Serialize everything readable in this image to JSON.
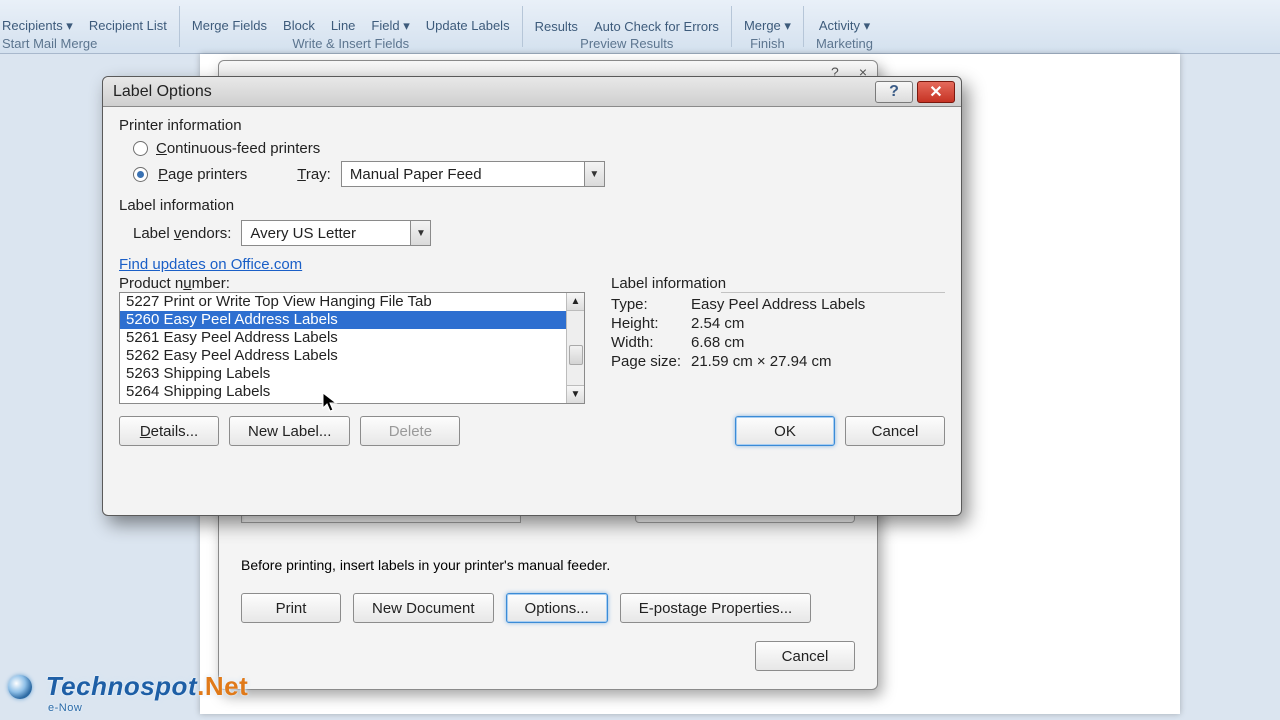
{
  "ribbon": {
    "items_top": [
      "Recipients ▾",
      "Recipient List",
      "Merge Fields",
      "Block",
      "Line",
      "Field ▾",
      "Update Labels",
      "Results",
      "Auto Check for Errors",
      "Merge ▾",
      "Activity ▾"
    ],
    "groups": [
      "Start Mail Merge",
      "Write & Insert Fields",
      "Preview Results",
      "Finish",
      "Marketing"
    ]
  },
  "dialog": {
    "title": "Label Options",
    "printer_info_head": "Printer information",
    "radio_continuous": "Continuous-feed printers",
    "radio_page": "Page printers",
    "tray_label": "Tray:",
    "tray_value": "Manual Paper Feed",
    "label_info_head": "Label information",
    "vendors_label": "Label vendors:",
    "vendors_value": "Avery US Letter",
    "find_updates": "Find updates on Office.com",
    "product_number_label": "Product number:",
    "products": [
      "5227 Print or Write Top View Hanging File Tab",
      "5260 Easy Peel Address Labels",
      "5261 Easy Peel Address Labels",
      "5262 Easy Peel Address Labels",
      "5263 Shipping Labels",
      "5264 Shipping Labels"
    ],
    "selected_index": 1,
    "info_head": "Label information",
    "info": {
      "type_k": "Type:",
      "type_v": "Easy Peel Address Labels",
      "height_k": "Height:",
      "height_v": "2.54 cm",
      "width_k": "Width:",
      "width_v": "6.68 cm",
      "page_k": "Page size:",
      "page_v": "21.59 cm × 27.94 cm"
    },
    "buttons": {
      "details": "Details...",
      "new_label": "New Label...",
      "delete": "Delete",
      "ok": "OK",
      "cancel": "Cancel"
    }
  },
  "under_dialog": {
    "hint": "Before printing, insert labels in your printer's manual feeder.",
    "print": "Print",
    "new_doc": "New Document",
    "options": "Options...",
    "epostage": "E-postage Properties...",
    "cancel": "Cancel"
  },
  "watermark": {
    "text": "Technospot",
    "suffix": ".Net",
    "sub": "e-Now"
  }
}
